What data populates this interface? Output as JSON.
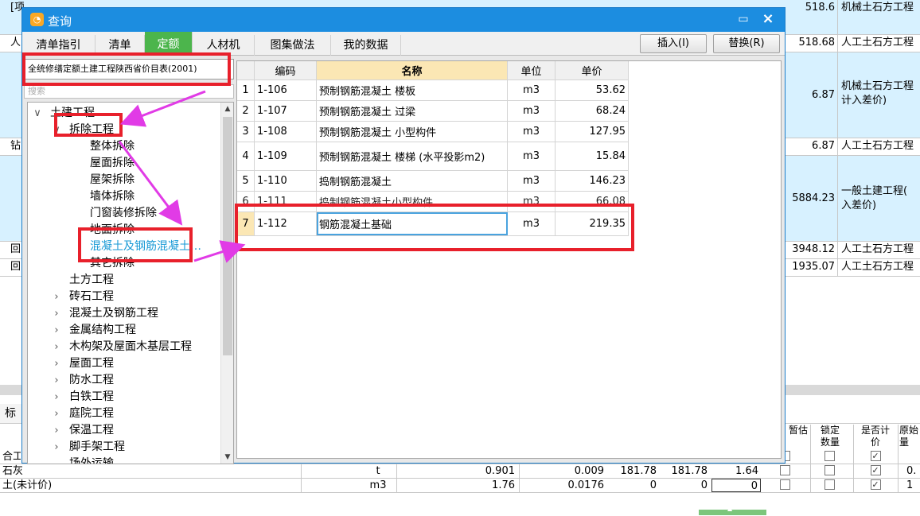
{
  "bg_rows": [
    {
      "left": "[项目特征]",
      "right_value": "518.6",
      "right_text": "机械土石方工程"
    },
    {
      "left": "人",
      "right_value": "518.68",
      "right_text": "人工土石方工程"
    },
    {
      "left": "",
      "right_value": "6.87",
      "right_text": "机械土石方工程 计入差价)"
    },
    {
      "left": "钻",
      "right_value": "6.87",
      "right_text": "人工土石方工程"
    },
    {
      "left": "",
      "right_value": "5884.23",
      "right_text": "一般土建工程( 入差价)"
    },
    {
      "left": "回",
      "right_value": "3948.12",
      "right_text": "人工土石方工程"
    },
    {
      "left": "回",
      "right_value": "1935.07",
      "right_text": "人工土石方工程"
    }
  ],
  "bottom": {
    "tab_label": "标",
    "headers": [
      "暂估",
      "锁定数量",
      "是否计价",
      "原始量"
    ],
    "row1_left": "合工",
    "row2": {
      "name": "石灰",
      "unit": "t",
      "v1": "0.901",
      "v2": "0.009",
      "v3": "181.78",
      "v4": "181.78",
      "v5": "1.64",
      "last": "0."
    },
    "row3": {
      "name": "土(未计价)",
      "unit": "m3",
      "v1": "1.76",
      "v2": "0.0176",
      "v3": "0",
      "v4": "0",
      "v5": "0",
      "last": "1"
    }
  },
  "dialog": {
    "title": "查询",
    "tabs": [
      "清单指引",
      "清单",
      "定额",
      "人材机",
      "图集做法",
      "我的数据"
    ],
    "active_tab": "定额",
    "insert_button": "插入(I)",
    "replace_button": "替换(R)",
    "library": "全统修缮定额土建工程陕西省价目表(2001)",
    "search_placeholder": "搜索",
    "tree": {
      "root": "土建工程",
      "demolition": "拆除工程",
      "demolition_children": [
        "整体拆除",
        "屋面拆除",
        "屋架拆除",
        "墙体拆除",
        "门窗装修拆除",
        "地面拆除",
        "混凝土及钢筋混凝土…",
        "其它拆除"
      ],
      "other": [
        "土方工程",
        "砖石工程",
        "混凝土及钢筋工程",
        "金属结构工程",
        "木构架及屋面木基层工程",
        "屋面工程",
        "防水工程",
        "白铁工程",
        "庭院工程",
        "保温工程",
        "脚手架工程",
        "场外运输"
      ]
    },
    "grid": {
      "headers": [
        "编码",
        "名称",
        "单位",
        "单价"
      ],
      "rows": [
        {
          "idx": "1",
          "code": "1-106",
          "name": "预制钢筋混凝土 楼板",
          "unit": "m3",
          "price": "53.62"
        },
        {
          "idx": "2",
          "code": "1-107",
          "name": "预制钢筋混凝土 过梁",
          "unit": "m3",
          "price": "68.24"
        },
        {
          "idx": "3",
          "code": "1-108",
          "name": "预制钢筋混凝土 小型构件",
          "unit": "m3",
          "price": "127.95"
        },
        {
          "idx": "4",
          "code": "1-109",
          "name": "预制钢筋混凝土 楼梯 (水平投影m2)",
          "unit": "m3",
          "price": "15.84"
        },
        {
          "idx": "5",
          "code": "1-110",
          "name": "捣制钢筋混凝土",
          "unit": "m3",
          "price": "146.23"
        },
        {
          "idx": "6",
          "code": "1-111",
          "name": "捣制钢筋混凝土小型构件",
          "unit": "m3",
          "price": "66.08"
        },
        {
          "idx": "7",
          "code": "1-112",
          "name": "钢筋混凝土基础",
          "unit": "m3",
          "price": "219.35"
        }
      ]
    }
  },
  "colors": {
    "accent": "#1c8de0",
    "active_tab": "#4cb54c",
    "highlight": "#e8202b",
    "arrow": "#e13be6",
    "selected_tree": "#1a9ad6"
  }
}
